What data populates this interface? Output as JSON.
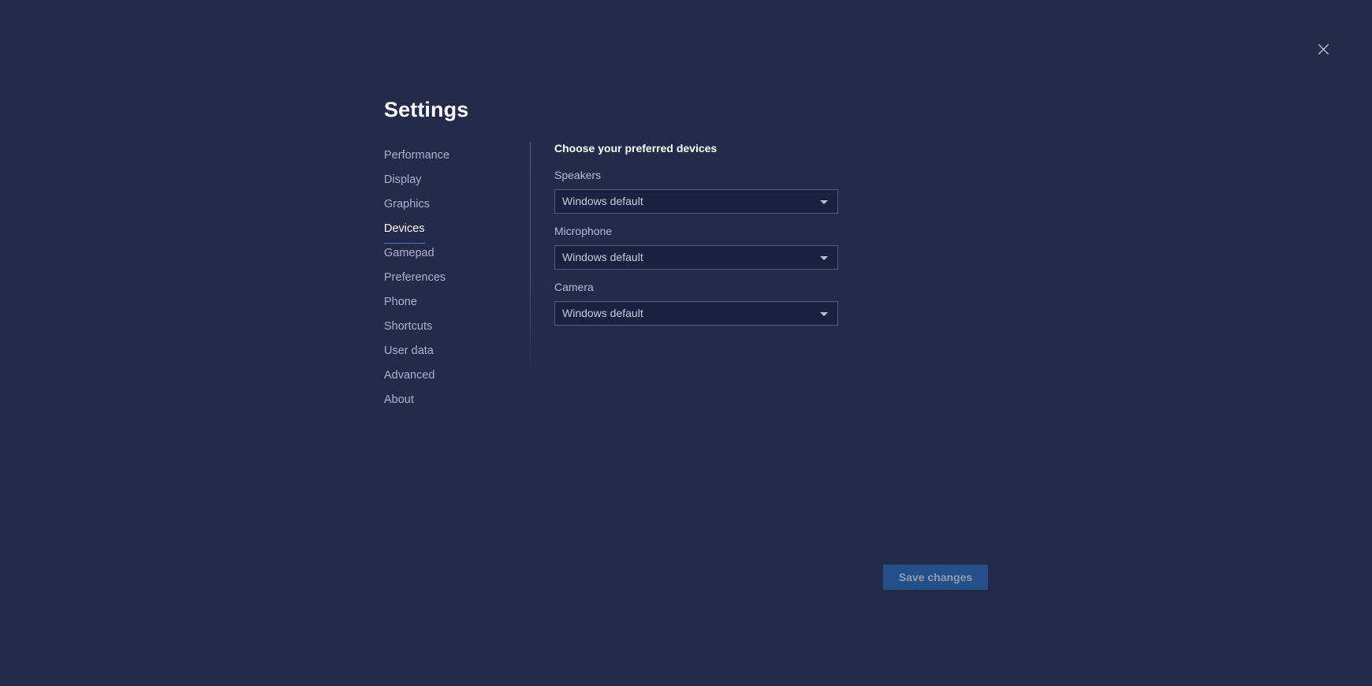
{
  "window": {
    "background_color": "#242b4a",
    "close_icon": "close-icon"
  },
  "header": {
    "title": "Settings"
  },
  "sidebar": {
    "items": [
      {
        "label": "Performance",
        "active": false
      },
      {
        "label": "Display",
        "active": false
      },
      {
        "label": "Graphics",
        "active": false
      },
      {
        "label": "Devices",
        "active": true
      },
      {
        "label": "Gamepad",
        "active": false
      },
      {
        "label": "Preferences",
        "active": false
      },
      {
        "label": "Phone",
        "active": false
      },
      {
        "label": "Shortcuts",
        "active": false
      },
      {
        "label": "User data",
        "active": false
      },
      {
        "label": "Advanced",
        "active": false
      },
      {
        "label": "About",
        "active": false
      }
    ],
    "active_indicator_color": "#3b7fd4"
  },
  "main": {
    "heading": "Choose your preferred devices",
    "fields": [
      {
        "label": "Speakers",
        "value": "Windows default",
        "arrow_icon": "chevron-down-icon"
      },
      {
        "label": "Microphone",
        "value": "Windows default",
        "arrow_icon": "chevron-down-icon"
      },
      {
        "label": "Camera",
        "value": "Windows default",
        "arrow_icon": "chevron-down-icon"
      }
    ]
  },
  "footer": {
    "save_label": "Save changes",
    "save_color": "#245089"
  }
}
